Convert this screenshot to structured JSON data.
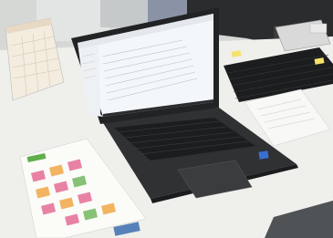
{
  "scene": {
    "colors": {
      "desk": "#efefec",
      "wall": "#cfd2d4",
      "laptop_body": "#2f3133",
      "keyboard": "#1c1d1f",
      "screen_glow": "#f4f7f9",
      "calendar_green": "#5fae4a",
      "calendar_pink": "#e25a8a",
      "calendar_orange": "#f0a23a"
    },
    "icons": [
      "laptop-icon",
      "keyboard-icon",
      "calendar-icon",
      "desk-phone-icon",
      "monitor-icon"
    ]
  },
  "captions": {
    "calendar_header": "",
    "desk_note": ""
  }
}
